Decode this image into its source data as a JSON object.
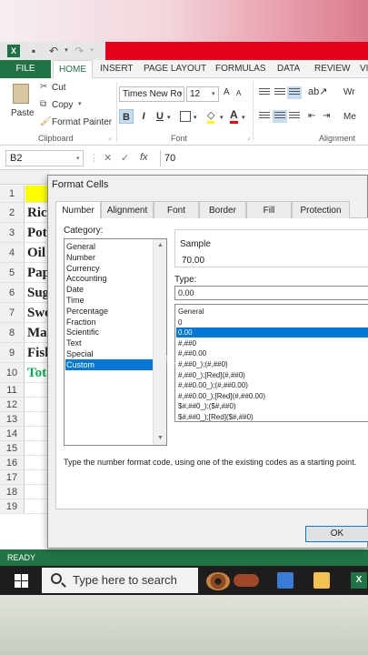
{
  "app": {
    "tabs": [
      "FILE",
      "HOME",
      "INSERT",
      "PAGE LAYOUT",
      "FORMULAS",
      "DATA",
      "REVIEW",
      "VI"
    ],
    "active_tab": "HOME"
  },
  "ribbon": {
    "paste_label": "Paste",
    "cut_label": "Cut",
    "copy_label": "Copy",
    "format_painter_label": "Format Painter",
    "clipboard_group": "Clipboard",
    "font_name": "Times New Ro",
    "font_size": "12",
    "font_group": "Font",
    "alignment_group": "Alignment",
    "wrap_label": "Wr",
    "merge_label": "Me",
    "bold": "B",
    "italic": "I",
    "underline": "U",
    "font_color_glyph": "A"
  },
  "formula_bar": {
    "name_box": "B2",
    "fx": "fx",
    "value": "70"
  },
  "sheet": {
    "rows": [
      {
        "num": "1",
        "a": ""
      },
      {
        "num": "2",
        "a": "Ric"
      },
      {
        "num": "3",
        "a": "Pot"
      },
      {
        "num": "4",
        "a": "Oil"
      },
      {
        "num": "5",
        "a": "Pap"
      },
      {
        "num": "6",
        "a": "Sug"
      },
      {
        "num": "7",
        "a": "Swe"
      },
      {
        "num": "8",
        "a": "Ma"
      },
      {
        "num": "9",
        "a": "Fish"
      },
      {
        "num": "10",
        "a": "Tota"
      },
      {
        "num": "11",
        "a": ""
      },
      {
        "num": "12",
        "a": ""
      },
      {
        "num": "13",
        "a": ""
      },
      {
        "num": "14",
        "a": ""
      },
      {
        "num": "15",
        "a": ""
      },
      {
        "num": "16",
        "a": ""
      },
      {
        "num": "17",
        "a": ""
      },
      {
        "num": "18",
        "a": ""
      },
      {
        "num": "19",
        "a": ""
      }
    ],
    "header_fill": "#ffff00",
    "total_color": "#00b050"
  },
  "status": {
    "text": "READY"
  },
  "taskbar": {
    "search_placeholder": "Type here to search"
  },
  "dialog": {
    "title": "Format Cells",
    "tabs": [
      "Number",
      "Alignment",
      "Font",
      "Border",
      "Fill",
      "Protection"
    ],
    "active_tab": "Number",
    "category_label": "Category:",
    "categories": [
      "General",
      "Number",
      "Currency",
      "Accounting",
      "Date",
      "Time",
      "Percentage",
      "Fraction",
      "Scientific",
      "Text",
      "Special",
      "Custom"
    ],
    "selected_category": "Custom",
    "sample_label": "Sample",
    "sample_value": "70.00",
    "type_label": "Type:",
    "type_value": "0.00",
    "formats": [
      "General",
      "0",
      "0.00",
      "#,##0",
      "#,##0.00",
      "#,##0_);(#,##0)",
      "#,##0_);[Red](#,##0)",
      "#,##0.00_);(#,##0.00)",
      "#,##0.00_);[Red](#,##0.00)",
      "$#,##0_);($#,##0)",
      "$#,##0_);[Red]($#,##0)"
    ],
    "selected_format": "0.00",
    "hint": "Type the number format code, using one of the existing codes as a starting point.",
    "ok_label": "OK"
  }
}
